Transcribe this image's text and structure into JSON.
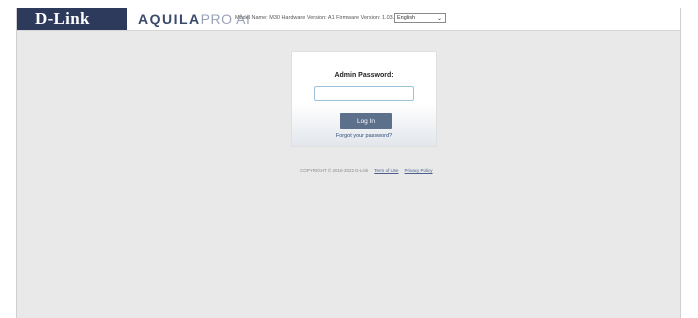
{
  "header": {
    "brand": "D-Link",
    "product_bold": "AQUILA",
    "product_light": "PRO AI",
    "info": "Model Name: M30 Hardware Version: A1 Firmware Version: 1.03.02",
    "language": "English"
  },
  "login": {
    "title": "Admin Password:",
    "password_value": "",
    "button_label": "Log In",
    "forgot_label": "Forgot your password?"
  },
  "footer": {
    "copyright": "COPYRIGHT © 2016-2022 D-Link",
    "terms": "Term of Use",
    "privacy": "Privacy Policy"
  },
  "colors": {
    "brand_bg": "#2e3a5c",
    "button_bg": "#5c6f8b",
    "page_bg": "#e9e9e9"
  }
}
